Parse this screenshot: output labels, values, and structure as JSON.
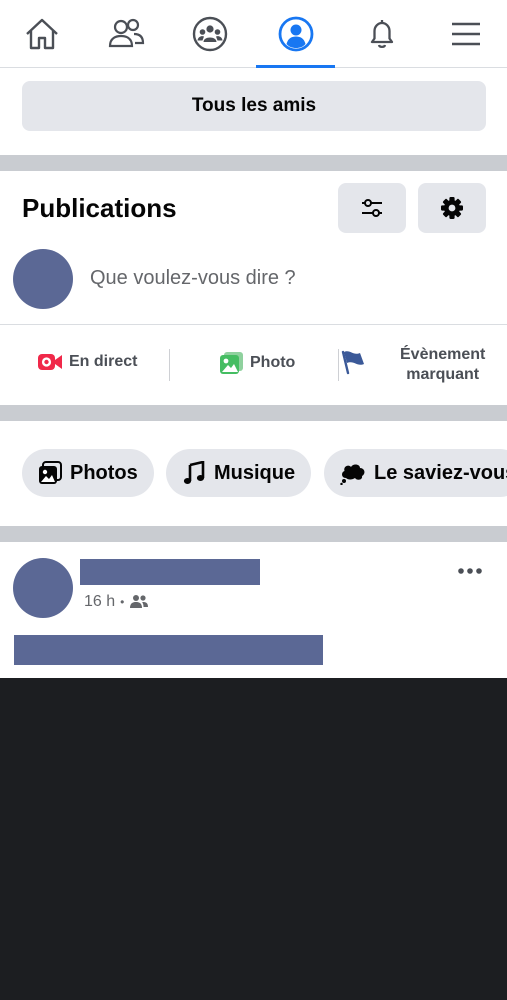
{
  "nav": {
    "items": [
      {
        "icon": "home-icon"
      },
      {
        "icon": "friends-icon"
      },
      {
        "icon": "groups-icon"
      },
      {
        "icon": "profile-icon",
        "active": true
      },
      {
        "icon": "bell-icon"
      },
      {
        "icon": "menu-icon"
      }
    ],
    "accent_color": "#1877f2"
  },
  "friends_button": {
    "label": "Tous les amis"
  },
  "publications": {
    "title": "Publications",
    "composer_placeholder": "Que voulez-vous dire ?",
    "actions": [
      {
        "label": "En direct",
        "icon": "live-video-icon",
        "color": "#f02849"
      },
      {
        "label": "Photo",
        "icon": "photo-icon",
        "color": "#45bd62"
      },
      {
        "label_line1": "Évènement",
        "label_line2": "marquant",
        "icon": "flag-icon",
        "color": "#3b5998"
      }
    ]
  },
  "chips": [
    {
      "label": "Photos",
      "icon": "photos-icon"
    },
    {
      "label": "Musique",
      "icon": "music-note-icon"
    },
    {
      "label": "Le saviez-vous",
      "icon": "thought-bubble-icon"
    }
  ],
  "post": {
    "time": "16 h",
    "separator": "•",
    "audience_icon": "friends-audience-icon",
    "more_icon": "more-options-icon"
  }
}
